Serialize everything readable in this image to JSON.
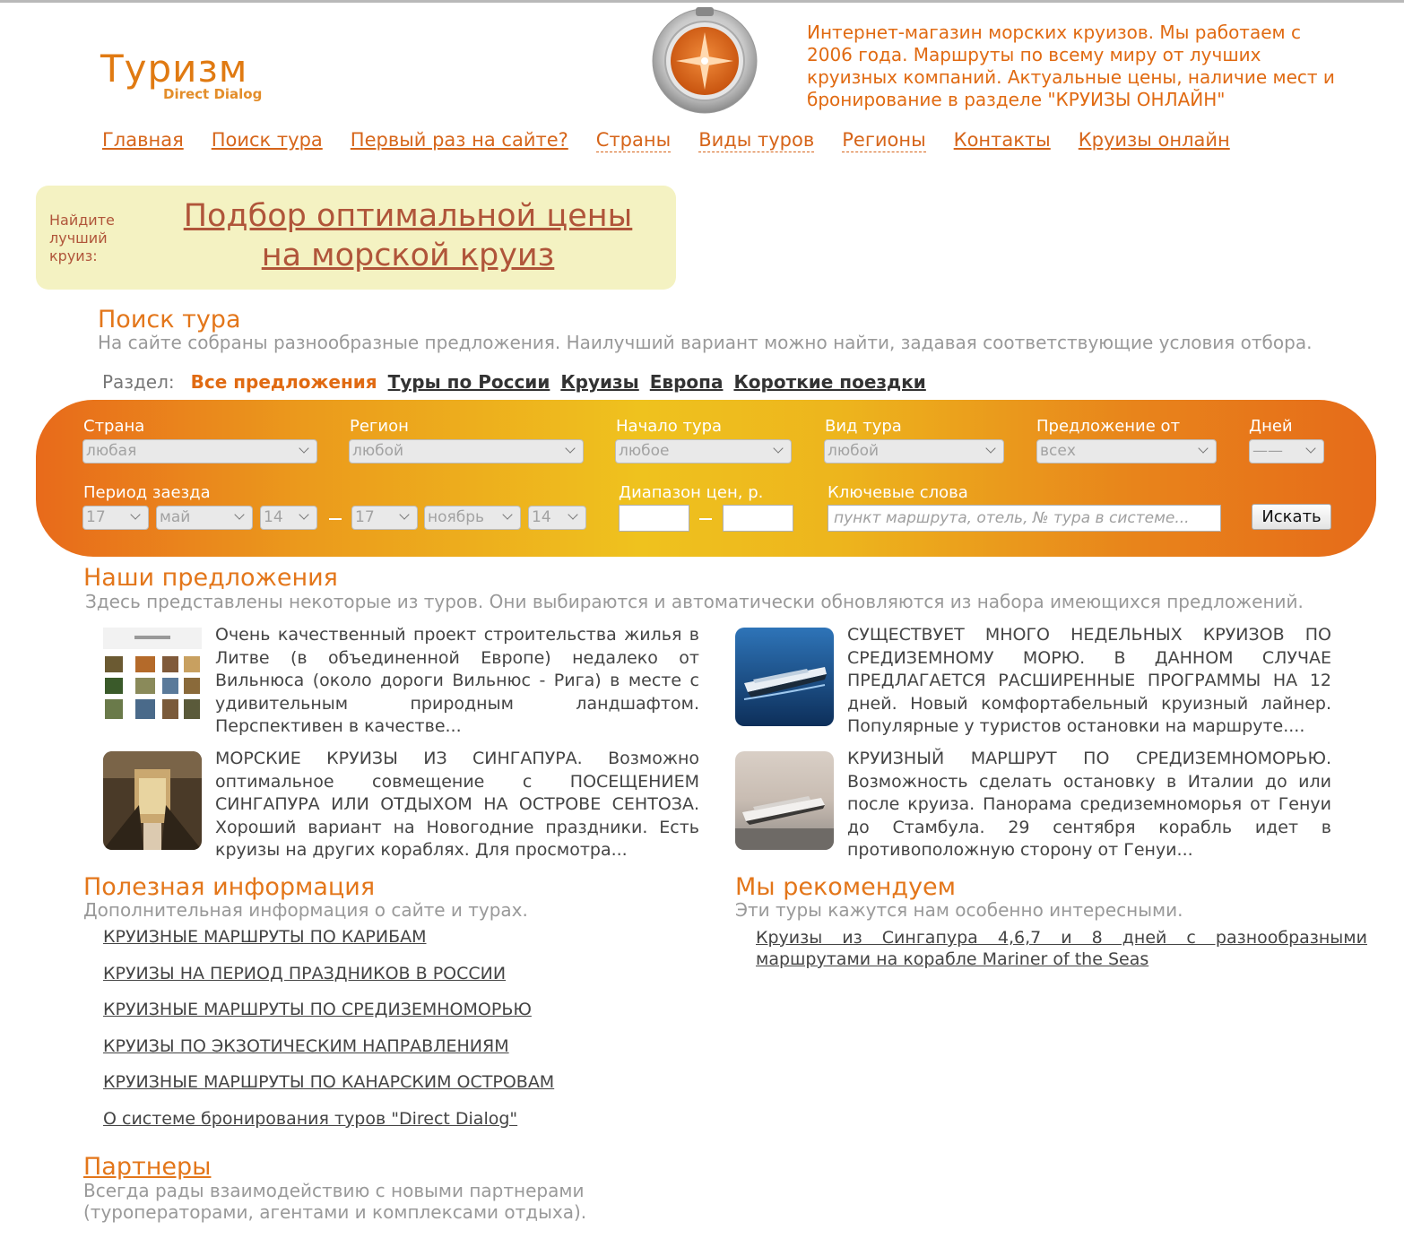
{
  "header": {
    "logo_main": "Туризм",
    "logo_sub": "Direct Dialog",
    "description": "Интернет-магазин морских круизов. Мы работаем с 2006 года. Маршруты по всему миру от лучших круизных компаний. Актуальные цены, наличие мест и бронирование в разделе \"КРУИЗЫ ОНЛАЙН\""
  },
  "nav": [
    {
      "label": "Главная",
      "style": "solid"
    },
    {
      "label": "Поиск тура",
      "style": "solid"
    },
    {
      "label": "Первый раз на сайте?",
      "style": "solid"
    },
    {
      "label": "Страны",
      "style": "dotted"
    },
    {
      "label": "Виды туров",
      "style": "dotted"
    },
    {
      "label": "Регионы",
      "style": "dotted"
    },
    {
      "label": "Контакты",
      "style": "solid"
    },
    {
      "label": "Круизы онлайн",
      "style": "solid"
    }
  ],
  "promo": {
    "label": "Найдите лучший круиз:",
    "link_line1": "Подбор оптимальной цены",
    "link_line2": "на морской круиз"
  },
  "search_section": {
    "title": "Поиск тура",
    "subtitle": "На сайте собраны разнообразные предложения. Наилучший вариант можно найти, задавая соответствующие условия отбора."
  },
  "tabs": {
    "label": "Раздел:",
    "items": [
      "Все предложения",
      "Туры по России",
      "Круизы",
      "Европа",
      "Короткие поездки"
    ]
  },
  "form": {
    "country_label": "Страна",
    "country_value": "любая",
    "region_label": "Регион",
    "region_value": "любой",
    "start_label": "Начало тура",
    "start_value": "любое",
    "type_label": "Вид тура",
    "type_value": "любой",
    "offer_label": "Предложение от",
    "offer_value": "всех",
    "days_label": "Дней",
    "days_value": "——",
    "period_label": "Период заезда",
    "period_from_day": "17",
    "period_from_month": "май",
    "period_from_year": "14",
    "period_to_day": "17",
    "period_to_month": "ноябрь",
    "period_to_year": "14",
    "price_label": "Диапазон цен, р.",
    "keywords_label": "Ключевые слова",
    "keywords_placeholder": "пункт маршрута, отель, № тура в системе...",
    "search_button": "Искать"
  },
  "offers_section": {
    "title": "Наши предложения",
    "subtitle": "Здесь представлены некоторые из туров. Они выбираются и автоматически обновляются из набора имеющихся предложений."
  },
  "offers": [
    {
      "text": "Очень качественный проект строительства жилья в Литве (в объединенной Европе) недалеко от Вильнюса (около дороги Вильнюс - Рига) в месте с удивительным природным ландшафтом. Перспективен в качестве..."
    },
    {
      "text": "СУЩЕСТВУЕТ МНОГО НЕДЕЛЬНЫХ КРУИЗОВ ПО СРЕДИЗЕМНОМУ МОРЮ. В ДАННОМ СЛУЧАЕ ПРЕДЛАГАЕТСЯ РАСШИРЕННЫЕ ПРОГРАММЫ НА 12 дней. Новый комфортабельный круизный лайнер. Популярные у туристов остановки на маршруте...."
    },
    {
      "text": "МОРСКИЕ КРУИЗЫ ИЗ СИНГАПУРА. Возможно оптимальное совмещение с ПОСЕЩЕНИЕМ СИНГАПУРА ИЛИ ОТДЫХОМ НА ОСТРОВЕ СЕНТОЗА. Хороший вариант на Новогодние праздники. Есть круизы на других кораблях. Для просмотра..."
    },
    {
      "text": "КРУИЗНЫЙ МАРШРУТ ПО СРЕДИЗЕМНОМОРЬЮ. Возможность сделать остановку в Италии до или после круиза. Панорама средиземноморья от Генуи до Стамбула. 29 сентября корабль идет в противоположную сторону от Генуи..."
    }
  ],
  "useful": {
    "title": "Полезная информация",
    "subtitle": "Дополнительная информация о сайте и турах.",
    "links": [
      "КРУИЗНЫЕ МАРШРУТЫ ПО КАРИБАМ",
      "КРУИЗЫ НА ПЕРИОД ПРАЗДНИКОВ В РОССИИ",
      "КРУИЗНЫЕ МАРШРУТЫ ПО СРЕДИЗЕМНОМОРЬЮ",
      "КРУИЗЫ ПО ЭКЗОТИЧЕСКИМ НАПРАВЛЕНИЯМ",
      "КРУИЗНЫЕ МАРШРУТЫ ПО КАНАРСКИМ ОСТРОВАМ",
      "О системе бронирования туров \"Direct Dialog\""
    ]
  },
  "recommend": {
    "title": "Мы рекомендуем",
    "subtitle": "Эти туры кажутся нам особенно интересными.",
    "link": "Круизы из Сингапура 4,6,7 и 8 дней с разнообразными маршрутами на корабле Mariner of the Seas"
  },
  "partners": {
    "title": "Партнеры",
    "subtitle_line1": "Всегда рады взаимодействию с новыми партнерами",
    "subtitle_line2": "(туроператорами, агентами и комплексами отдыха)."
  },
  "colors": {
    "accent": "#e3761a",
    "promo_bg": "#f4f2c2",
    "promo_link": "#b0553a"
  }
}
